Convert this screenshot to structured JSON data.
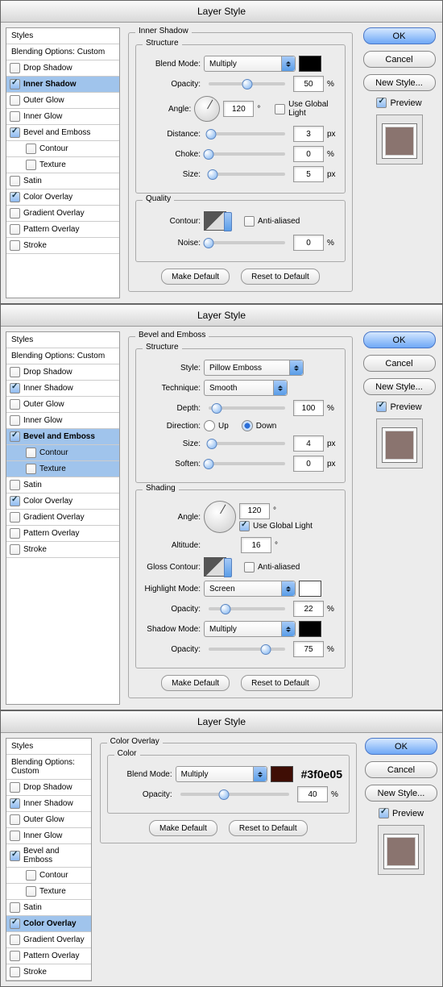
{
  "title": "Layer Style",
  "btns": {
    "ok": "OK",
    "cancel": "Cancel",
    "new": "New Style...",
    "preview": "Preview",
    "md": "Make Default",
    "rd": "Reset to Default"
  },
  "sb": {
    "styles": "Styles",
    "blend": "Blending Options: Custom",
    "items": [
      "Drop Shadow",
      "Inner Shadow",
      "Outer Glow",
      "Inner Glow",
      "Bevel and Emboss",
      "Contour",
      "Texture",
      "Satin",
      "Color Overlay",
      "Gradient Overlay",
      "Pattern Overlay",
      "Stroke"
    ]
  },
  "p1": {
    "title": "Inner Shadow",
    "structure": "Structure",
    "quality": "Quality",
    "blend": "Blend Mode:",
    "blendv": "Multiply",
    "opacity": "Opacity:",
    "opv": "50",
    "pct": "%",
    "angle": "Angle:",
    "anglev": "120",
    "deg": "°",
    "ugl": "Use Global Light",
    "dist": "Distance:",
    "distv": "3",
    "px": "px",
    "choke": "Choke:",
    "chokev": "0",
    "size": "Size:",
    "sizev": "5",
    "contour": "Contour:",
    "aa": "Anti-aliased",
    "noise": "Noise:",
    "noisev": "0"
  },
  "p2": {
    "title": "Bevel and Emboss",
    "structure": "Structure",
    "shading": "Shading",
    "style": "Style:",
    "stylev": "Pillow Emboss",
    "tech": "Technique:",
    "techv": "Smooth",
    "depth": "Depth:",
    "depthv": "100",
    "dir": "Direction:",
    "up": "Up",
    "down": "Down",
    "size": "Size:",
    "sizev": "4",
    "soften": "Soften:",
    "softenv": "0",
    "angle": "Angle:",
    "anglev": "120",
    "ugl": "Use Global Light",
    "alt": "Altitude:",
    "altv": "16",
    "gloss": "Gloss Contour:",
    "aa": "Anti-aliased",
    "hmode": "Highlight Mode:",
    "hmodev": "Screen",
    "hop": "Opacity:",
    "hopv": "22",
    "smode": "Shadow Mode:",
    "smodev": "Multiply",
    "sop": "Opacity:",
    "sopv": "75",
    "pct": "%",
    "px": "px",
    "deg": "°"
  },
  "p3": {
    "title": "Color Overlay",
    "color": "Color",
    "blend": "Blend Mode:",
    "blendv": "Multiply",
    "hex": "#3f0e05",
    "opacity": "Opacity:",
    "opv": "40",
    "pct": "%"
  }
}
